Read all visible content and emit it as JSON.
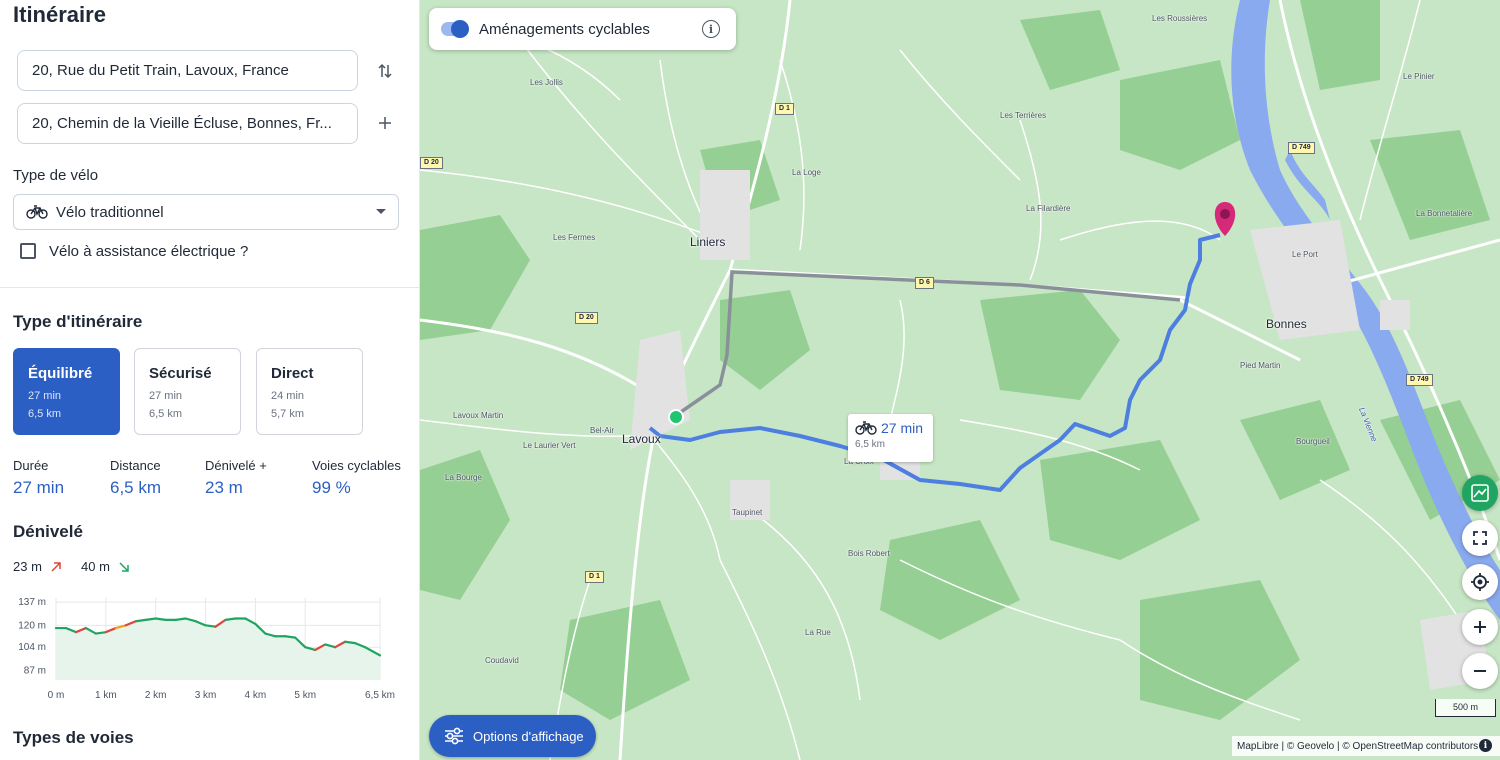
{
  "sidebar": {
    "title": "Itinéraire",
    "start_address": "20, Rue du Petit Train, Lavoux, France",
    "end_address": "20, Chemin de la Vieille Écluse, Bonnes, Fr...",
    "swap_icon": "swap-vertical-icon",
    "add_icon": "plus-icon",
    "bike_type_label": "Type de vélo",
    "bike_type_value": "Vélo traditionnel",
    "ebike_label": "Vélo à assistance électrique ?",
    "ebike_checked": false,
    "route_type_label": "Type d'itinéraire",
    "route_options": [
      {
        "name": "Équilibré",
        "duration": "27 min",
        "distance": "6,5 km",
        "selected": true
      },
      {
        "name": "Sécurisé",
        "duration": "27 min",
        "distance": "6,5 km",
        "selected": false
      },
      {
        "name": "Direct",
        "duration": "24 min",
        "distance": "5,7 km",
        "selected": false
      }
    ],
    "stats": [
      {
        "label": "Durée",
        "value": "27 min"
      },
      {
        "label": "Distance",
        "value": "6,5 km"
      },
      {
        "label": "Dénivelé +",
        "value": "23 m"
      },
      {
        "label": "Voies cyclables",
        "value": "99 %"
      }
    ],
    "elevation_title": "Dénivelé",
    "elevation_up": "23 m",
    "elevation_down": "40 m",
    "road_types_title": "Types de voies"
  },
  "chart_data": {
    "type": "line",
    "title": "",
    "xlabel": "",
    "ylabel": "",
    "y_ticks": [
      "137 m",
      "120 m",
      "104 m",
      "87 m"
    ],
    "y_tick_values": [
      137,
      120,
      104,
      87
    ],
    "x_ticks": [
      "0 m",
      "1 km",
      "2 km",
      "3 km",
      "4 km",
      "5 km",
      "6,5 km"
    ],
    "x_tick_values": [
      0,
      1,
      2,
      3,
      4,
      5,
      6.5
    ],
    "xlim": [
      0,
      6.5
    ],
    "ylim": [
      80,
      140
    ],
    "grid": true,
    "series": [
      {
        "x": [
          0,
          0.2,
          0.4,
          0.6,
          0.8,
          1.0,
          1.2,
          1.4,
          1.6,
          1.8,
          2.0,
          2.2,
          2.4,
          2.6,
          2.8,
          3.0,
          3.2,
          3.4,
          3.6,
          3.8,
          4.0,
          4.2,
          4.4,
          4.6,
          4.8,
          5.0,
          5.2,
          5.4,
          5.6,
          5.8,
          6.0,
          6.2,
          6.5
        ],
        "y": [
          118,
          118,
          115,
          118,
          114,
          115,
          118,
          120,
          123,
          124,
          125,
          124,
          124,
          125,
          123,
          120,
          119,
          124,
          125,
          125,
          121,
          114,
          112,
          112,
          111,
          104,
          102,
          106,
          104,
          108,
          107,
          104,
          98
        ]
      }
    ]
  },
  "map": {
    "cycle_toggle_label": "Aménagements cyclables",
    "cycle_toggle_on": true,
    "towns": [
      "Liniers",
      "Lavoux",
      "Bonnes"
    ],
    "places": [
      "Les Roussières",
      "Le Pinier",
      "Les Jollis",
      "Les Terrières",
      "La Loge",
      "La Filardière",
      "La Bonnetalière",
      "Les Fermes",
      "Le Port",
      "Lavoux Martin",
      "Bel-Air",
      "Le Laurier Vert",
      "La Bourge",
      "Taupinet",
      "Bois Robert",
      "La Rue",
      "Coudavid",
      "Pied Martin",
      "Bourgueil",
      "La Croix",
      "La Vienne"
    ],
    "road_labels": [
      "D 1",
      "D 20",
      "D 20",
      "D 6",
      "D 749",
      "D 749",
      "D 1"
    ],
    "popup_time": "27 min",
    "popup_distance": "6,5 km",
    "options_button": "Options d'affichage",
    "scale": "500 m",
    "attribution": "MapLibre | © Geovelo | © OpenStreetMap contributors",
    "colors": {
      "route": "#4d7fe0",
      "water": "#8aaaf0",
      "accent": "#2c5fc4",
      "marker": "#d6297a"
    }
  }
}
